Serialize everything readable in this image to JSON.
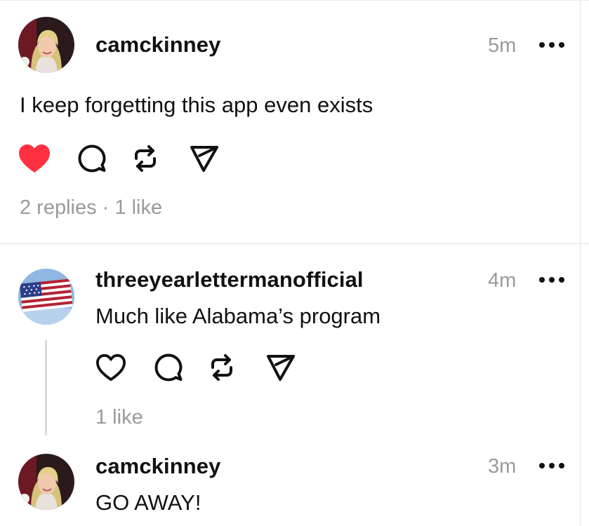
{
  "posts": [
    {
      "username": "camckinney",
      "time": "5m",
      "text": "I keep forgetting this app even exists",
      "liked": true,
      "stats": "2 replies · 1 like"
    },
    {
      "username": "threeyearlettermanofficial",
      "time": "4m",
      "text": "Much like Alabama’s program",
      "liked": false,
      "stats": "1 like"
    },
    {
      "username": "camckinney",
      "time": "3m",
      "text": "GO AWAY!"
    }
  ],
  "icons": {
    "like": "heart-icon",
    "reply": "comment-icon",
    "repost": "repost-icon",
    "share": "send-icon",
    "more": "more-icon"
  },
  "colors": {
    "like_active": "#ff3040",
    "muted_text": "#9a9a9a"
  }
}
